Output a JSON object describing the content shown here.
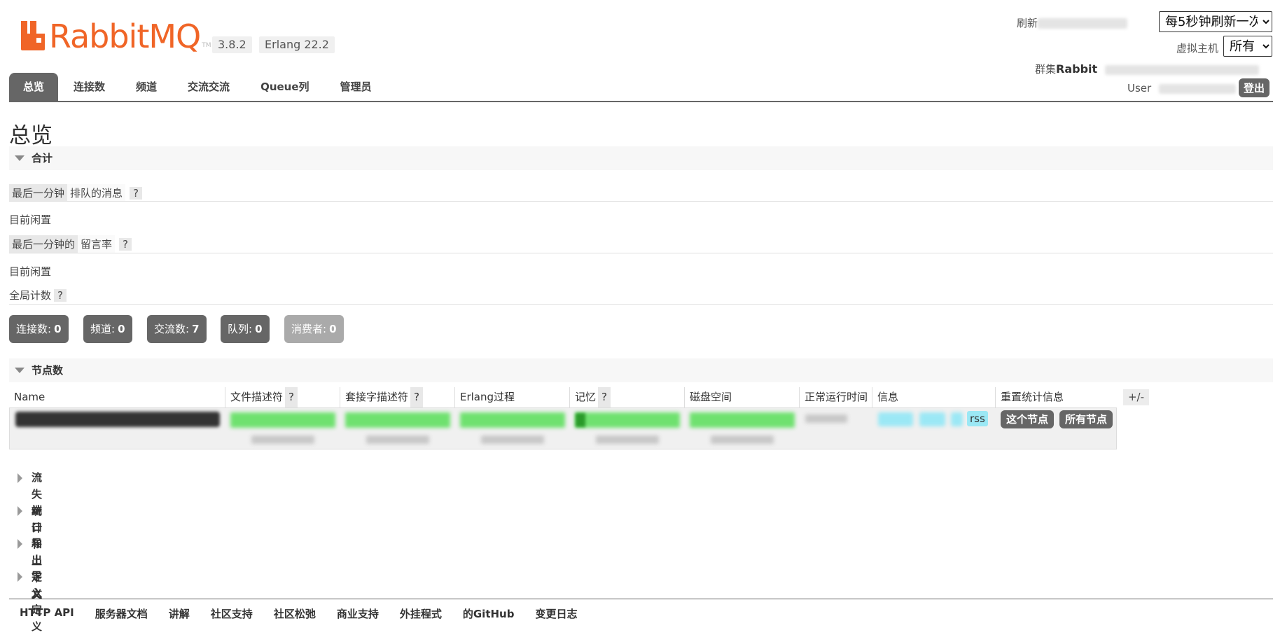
{
  "header": {
    "version": "3.8.2",
    "erlang": "Erlang 22.2",
    "refresh_label": "刷新",
    "refresh_select": "每5秒钟刷新一次",
    "vhost_label": "虚拟主机",
    "vhost_select": "所有",
    "cluster_label": "群集",
    "cluster_name": "Rabbit",
    "user_label": "User",
    "logout": "登出"
  },
  "tabs": [
    "总览",
    "连接数",
    "频道",
    "交流交流",
    "Queue列",
    "管理员"
  ],
  "page_title": "总览",
  "totals": {
    "section_label": "合计",
    "queued_pill": "最后一分钟",
    "queued_text": "排队的消息",
    "help": "?",
    "idle1": "目前闲置",
    "rate_pill": "最后一分钟的",
    "rate_text": "留言率",
    "idle2": "目前闲置",
    "global_counts": "全局计数"
  },
  "counters": [
    {
      "label": "连接数:",
      "value": "0"
    },
    {
      "label": "频道:",
      "value": "0"
    },
    {
      "label": "交流数:",
      "value": "7"
    },
    {
      "label": "队列:",
      "value": "0"
    },
    {
      "label": "消费者:",
      "value": "0"
    }
  ],
  "nodes": {
    "section_label": "节点数",
    "columns": [
      "Name",
      "文件描述符",
      "套接字描述符",
      "Erlang过程",
      "记忆",
      "磁盘空间",
      "正常运行时间",
      "信息",
      "重置统计信息"
    ],
    "rss": "rss",
    "this_node": "这个节点",
    "all_nodes": "所有节点",
    "plus_minus": "+/-"
  },
  "collapsed_sections": [
    "流失统计",
    "端口和上下文",
    "导出定义",
    "导入定义"
  ],
  "footer": [
    "HTTP API",
    "服务器文档",
    "讲解",
    "社区支持",
    "社区松弛",
    "商业支持",
    "外挂程式",
    "的GitHub",
    "变更日志"
  ],
  "colors": {
    "brand": "#f06527",
    "tab_active": "#666666",
    "bar_green": "#6fe16f",
    "rss_blue": "#9be8f5"
  }
}
